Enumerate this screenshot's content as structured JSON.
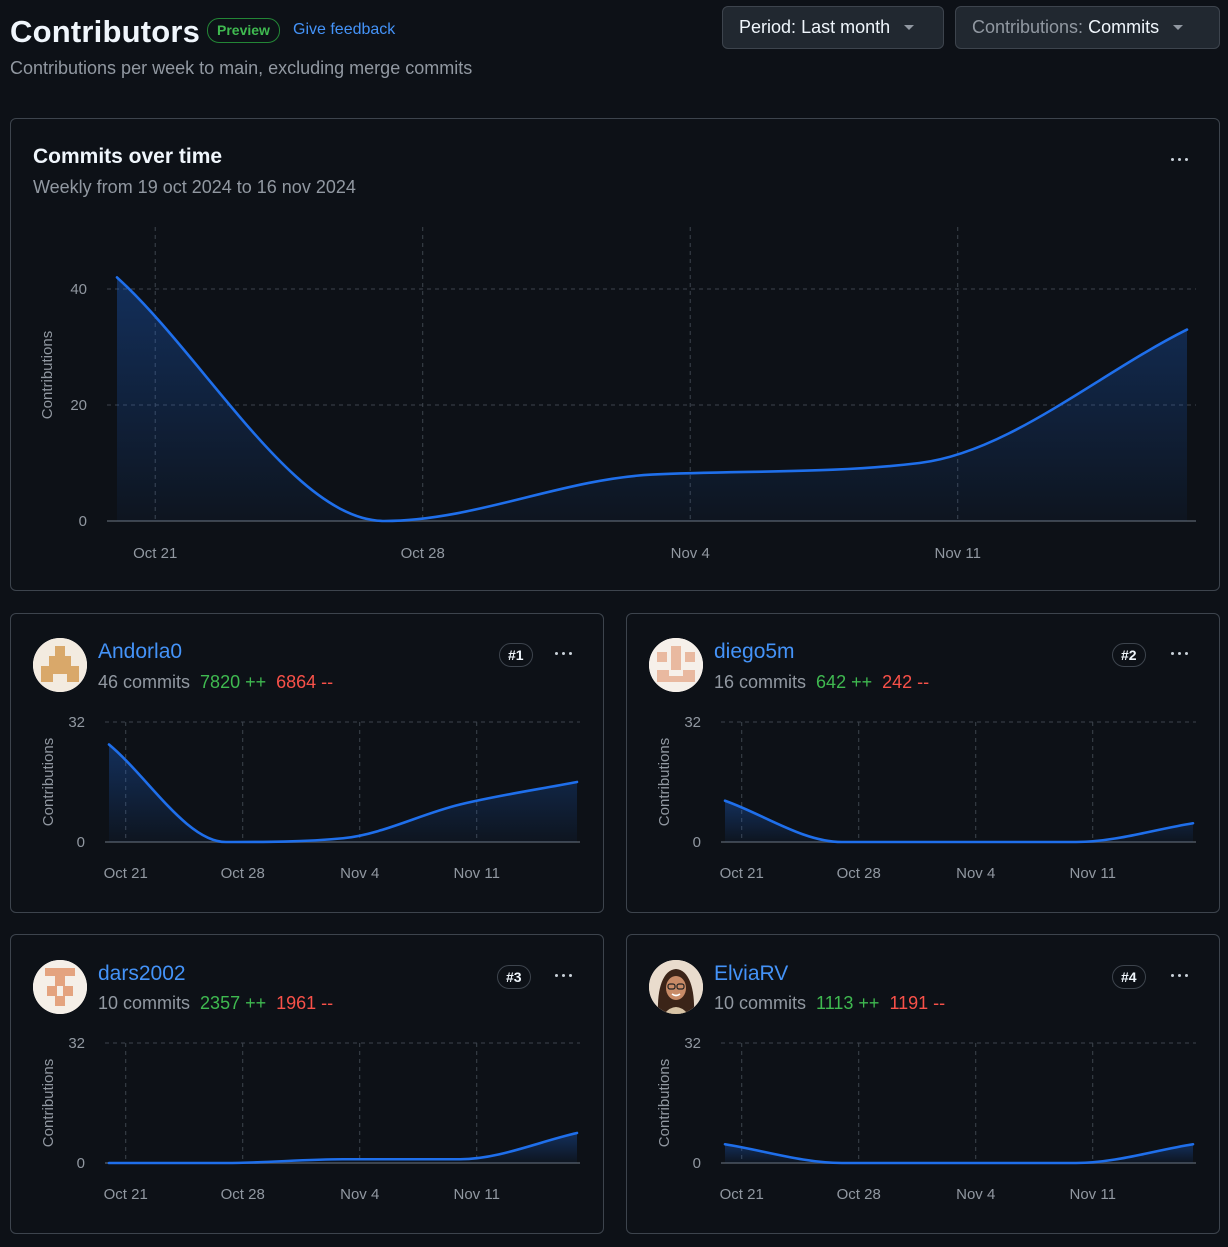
{
  "header": {
    "title": "Contributors",
    "preview_label": "Preview",
    "feedback_label": "Give feedback",
    "subtitle": "Contributions per week to main, excluding merge commits",
    "period_prefix": "Period:",
    "period_value": "Last month",
    "contrib_prefix": "Contributions:",
    "contrib_value": "Commits"
  },
  "colors": {
    "line": "#1f6feb",
    "added": "#3fb950",
    "deleted": "#f85149",
    "link": "#4493f8"
  },
  "main_chart": {
    "title": "Commits over time",
    "subtitle": "Weekly from 19 oct 2024 to 16 nov 2024"
  },
  "chart_data": [
    {
      "type": "area",
      "x": [
        "Oct 20",
        "Oct 27",
        "Nov 3",
        "Nov 10",
        "Nov 17"
      ],
      "xticks": [
        "Oct 21",
        "Oct 28",
        "Nov 4",
        "Nov 11"
      ],
      "values": [
        42,
        0,
        8,
        10,
        33
      ],
      "ylabel": "Contributions",
      "yticks": [
        0,
        20,
        40
      ],
      "ylim": [
        0,
        40
      ]
    },
    {
      "type": "area",
      "x": [
        "Oct 20",
        "Oct 27",
        "Nov 3",
        "Nov 10",
        "Nov 17"
      ],
      "xticks": [
        "Oct 21",
        "Oct 28",
        "Nov 4",
        "Nov 11"
      ],
      "values": [
        26,
        0,
        1,
        10,
        16
      ],
      "ylabel": "Contributions",
      "yticks": [
        0,
        32
      ],
      "ylim": [
        0,
        32
      ]
    },
    {
      "type": "area",
      "x": [
        "Oct 20",
        "Oct 27",
        "Nov 3",
        "Nov 10",
        "Nov 17"
      ],
      "xticks": [
        "Oct 21",
        "Oct 28",
        "Nov 4",
        "Nov 11"
      ],
      "values": [
        11,
        0,
        0,
        0,
        5
      ],
      "ylabel": "Contributions",
      "yticks": [
        0,
        32
      ],
      "ylim": [
        0,
        32
      ]
    },
    {
      "type": "area",
      "x": [
        "Oct 20",
        "Oct 27",
        "Nov 3",
        "Nov 10",
        "Nov 17"
      ],
      "xticks": [
        "Oct 21",
        "Oct 28",
        "Nov 4",
        "Nov 11"
      ],
      "values": [
        0,
        0,
        1,
        1,
        8
      ],
      "ylabel": "Contributions",
      "yticks": [
        0,
        32
      ],
      "ylim": [
        0,
        32
      ]
    },
    {
      "type": "area",
      "x": [
        "Oct 20",
        "Oct 27",
        "Nov 3",
        "Nov 10",
        "Nov 17"
      ],
      "xticks": [
        "Oct 21",
        "Oct 28",
        "Nov 4",
        "Nov 11"
      ],
      "values": [
        5,
        0,
        0,
        0,
        5
      ],
      "ylabel": "Contributions",
      "yticks": [
        0,
        32
      ],
      "ylim": [
        0,
        32
      ]
    }
  ],
  "contributors": [
    {
      "name": "Andorla0",
      "rank": "#1",
      "commits": "46 commits",
      "added": "7820 ++",
      "deleted": "6864 --"
    },
    {
      "name": "diego5m",
      "rank": "#2",
      "commits": "16 commits",
      "added": "642 ++",
      "deleted": "242 --"
    },
    {
      "name": "dars2002",
      "rank": "#3",
      "commits": "10 commits",
      "added": "2357 ++",
      "deleted": "1961 --"
    },
    {
      "name": "ElviaRV",
      "rank": "#4",
      "commits": "10 commits",
      "added": "1113 ++",
      "deleted": "1191 --"
    }
  ]
}
